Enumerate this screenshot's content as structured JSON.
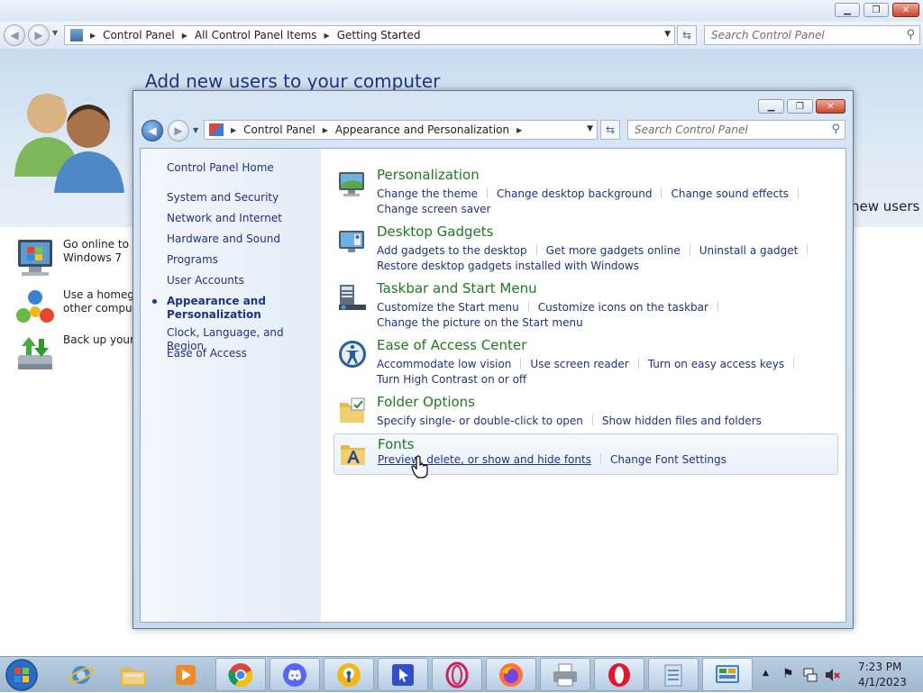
{
  "bg_window": {
    "breadcrumbs": [
      "Control Panel",
      "All Control Panel Items",
      "Getting Started"
    ],
    "search_placeholder": "Search Control Panel",
    "heading": "Add new users to your computer",
    "right_text": "new users",
    "tasks": [
      {
        "line1": "Go online to fi",
        "line2": "Windows 7"
      },
      {
        "line1": "Use a homegro",
        "line2": "other compute"
      },
      {
        "line1": "Back up your f",
        "line2": ""
      }
    ]
  },
  "main_window": {
    "breadcrumbs": [
      "Control Panel",
      "Appearance and Personalization"
    ],
    "search_placeholder": "Search Control Panel",
    "left_pane": {
      "home": "Control Panel Home",
      "items": [
        "System and Security",
        "Network and Internet",
        "Hardware and Sound",
        "Programs",
        "User Accounts",
        "Appearance and Personalization",
        "Clock, Language, and Region",
        "Ease of Access"
      ],
      "current_index": 5
    },
    "categories": [
      {
        "title": "Personalization",
        "icon": "personalization-icon",
        "links": [
          "Change the theme",
          "Change desktop background",
          "Change sound effects",
          "Change screen saver"
        ]
      },
      {
        "title": "Desktop Gadgets",
        "icon": "gadgets-icon",
        "links": [
          "Add gadgets to the desktop",
          "Get more gadgets online",
          "Uninstall a gadget",
          "Restore desktop gadgets installed with Windows"
        ]
      },
      {
        "title": "Taskbar and Start Menu",
        "icon": "taskbar-icon",
        "links": [
          "Customize the Start menu",
          "Customize icons on the taskbar",
          "Change the picture on the Start menu"
        ]
      },
      {
        "title": "Ease of Access Center",
        "icon": "ease-of-access-icon",
        "links": [
          "Accommodate low vision",
          "Use screen reader",
          "Turn on easy access keys",
          "Turn High Contrast on or off"
        ]
      },
      {
        "title": "Folder Options",
        "icon": "folder-options-icon",
        "links": [
          "Specify single- or double-click to open",
          "Show hidden files and folders"
        ]
      },
      {
        "title": "Fonts",
        "icon": "fonts-icon",
        "links": [
          "Preview, delete, or show and hide fonts",
          "Change Font Settings"
        ]
      }
    ]
  },
  "taskbar": {
    "apps": [
      "internet-explorer",
      "file-explorer",
      "media-player",
      "chrome",
      "discord",
      "keepass",
      "cursor-app",
      "opera-gx",
      "firefox",
      "printer",
      "opera",
      "notepad",
      "control-panel"
    ],
    "time": "7:23 PM",
    "date": "4/1/2023"
  }
}
